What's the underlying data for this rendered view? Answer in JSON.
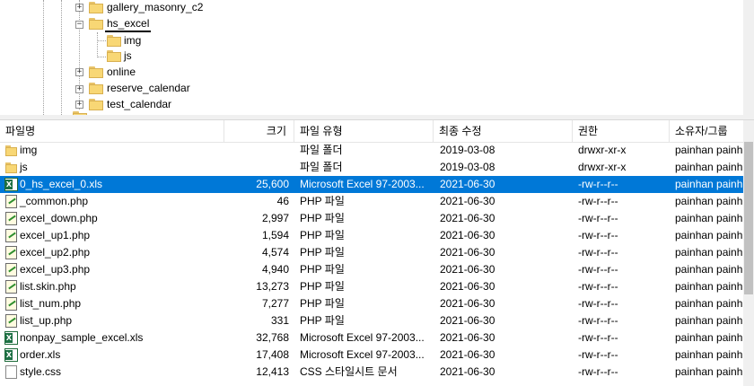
{
  "tree": {
    "nodes": [
      {
        "label": "gallery_masonry_c2",
        "expander": "+",
        "selected": false
      },
      {
        "label": "hs_excel",
        "expander": "−",
        "selected": true
      },
      {
        "label": "img",
        "expander": "",
        "selected": false
      },
      {
        "label": "js",
        "expander": "",
        "selected": false
      },
      {
        "label": "online",
        "expander": "+",
        "selected": false
      },
      {
        "label": "reserve_calendar",
        "expander": "+",
        "selected": false
      },
      {
        "label": "test_calendar",
        "expander": "+",
        "selected": false
      }
    ]
  },
  "list": {
    "columns": {
      "name": "파일명",
      "size": "크기",
      "type": "파일 유형",
      "modified": "최종 수정",
      "permissions": "권한",
      "owner": "소유자/그룹"
    },
    "sort_indicator": "^",
    "rows": [
      {
        "icon": "folder-icon",
        "name": "img",
        "size": "",
        "type": "파일 폴더",
        "modified": "2019-03-08",
        "permissions": "drwxr-xr-x",
        "owner": "painhan painh",
        "selected": false
      },
      {
        "icon": "folder-icon",
        "name": "js",
        "size": "",
        "type": "파일 폴더",
        "modified": "2019-03-08",
        "permissions": "drwxr-xr-x",
        "owner": "painhan painh",
        "selected": false
      },
      {
        "icon": "excel-file-icon",
        "name": "0_hs_excel_0.xls",
        "size": "25,600",
        "type": "Microsoft Excel 97-2003...",
        "modified": "2021-06-30",
        "permissions": "-rw-r--r--",
        "owner": "painhan painh",
        "selected": true
      },
      {
        "icon": "php-file-icon",
        "name": "_common.php",
        "size": "46",
        "type": "PHP 파일",
        "modified": "2021-06-30",
        "permissions": "-rw-r--r--",
        "owner": "painhan painh",
        "selected": false
      },
      {
        "icon": "php-file-icon",
        "name": "excel_down.php",
        "size": "2,997",
        "type": "PHP 파일",
        "modified": "2021-06-30",
        "permissions": "-rw-r--r--",
        "owner": "painhan painh",
        "selected": false
      },
      {
        "icon": "php-file-icon",
        "name": "excel_up1.php",
        "size": "1,594",
        "type": "PHP 파일",
        "modified": "2021-06-30",
        "permissions": "-rw-r--r--",
        "owner": "painhan painh",
        "selected": false
      },
      {
        "icon": "php-file-icon",
        "name": "excel_up2.php",
        "size": "4,574",
        "type": "PHP 파일",
        "modified": "2021-06-30",
        "permissions": "-rw-r--r--",
        "owner": "painhan painh",
        "selected": false
      },
      {
        "icon": "php-file-icon",
        "name": "excel_up3.php",
        "size": "4,940",
        "type": "PHP 파일",
        "modified": "2021-06-30",
        "permissions": "-rw-r--r--",
        "owner": "painhan painh",
        "selected": false
      },
      {
        "icon": "php-file-icon",
        "name": "list.skin.php",
        "size": "13,273",
        "type": "PHP 파일",
        "modified": "2021-06-30",
        "permissions": "-rw-r--r--",
        "owner": "painhan painh",
        "selected": false
      },
      {
        "icon": "php-file-icon",
        "name": "list_num.php",
        "size": "7,277",
        "type": "PHP 파일",
        "modified": "2021-06-30",
        "permissions": "-rw-r--r--",
        "owner": "painhan painh",
        "selected": false
      },
      {
        "icon": "php-file-icon",
        "name": "list_up.php",
        "size": "331",
        "type": "PHP 파일",
        "modified": "2021-06-30",
        "permissions": "-rw-r--r--",
        "owner": "painhan painh",
        "selected": false
      },
      {
        "icon": "excel-file-icon",
        "name": "nonpay_sample_excel.xls",
        "size": "32,768",
        "type": "Microsoft Excel 97-2003...",
        "modified": "2021-06-30",
        "permissions": "-rw-r--r--",
        "owner": "painhan painh",
        "selected": false
      },
      {
        "icon": "excel-file-icon",
        "name": "order.xls",
        "size": "17,408",
        "type": "Microsoft Excel 97-2003...",
        "modified": "2021-06-30",
        "permissions": "-rw-r--r--",
        "owner": "painhan painh",
        "selected": false
      },
      {
        "icon": "css-file-icon",
        "name": "style.css",
        "size": "12,413",
        "type": "CSS 스타일시트 문서",
        "modified": "2021-06-30",
        "permissions": "-rw-r--r--",
        "owner": "painhan painh",
        "selected": false
      }
    ]
  },
  "colors": {
    "selection": "#0078d7",
    "folder": "#f8d775"
  }
}
